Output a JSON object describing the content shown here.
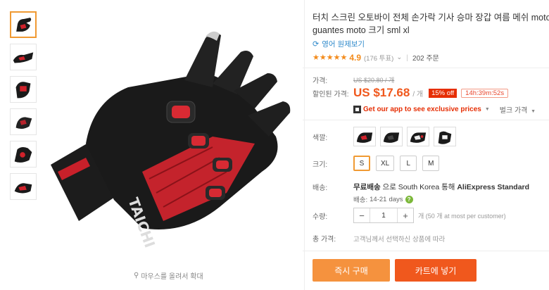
{
  "product": {
    "title_line1": "터치 스크린 오토바이 전체 손가락 기사 승마 장갑 여름 메쉬 moto",
    "title_line2": "guantes moto 크기 sml xl",
    "translate_link": "영어 원제보기",
    "stars": "★★★★★",
    "rating": "4.9",
    "votes": "(176 투표)",
    "votes_arrow": "⌄",
    "orders": "202 주문"
  },
  "price": {
    "label_price": "가격:",
    "old_price": "US $20.80 / 개",
    "label_discount": "할인된 가격:",
    "current": "US $17.68",
    "per_unit": "/ 개",
    "off_badge": "15% off",
    "timer": "14h:39m:52s",
    "app_promo": "Get our app to see exclusive prices",
    "bulk": "벌크 가격"
  },
  "options": {
    "color_label": "색깔:",
    "size_label": "크기:",
    "sizes": [
      "S",
      "XL",
      "L",
      "M"
    ],
    "selected_size": "S"
  },
  "shipping": {
    "label": "배송:",
    "main_pre": "무료배송",
    "main_mid": " 으로 South Korea 통해 ",
    "main_carrier": "AliExpress Standard",
    "sub_pre": "배송:",
    "sub_days": "14-21",
    "sub_unit": "days"
  },
  "quantity": {
    "label": "수량:",
    "minus": "−",
    "value": "1",
    "plus": "+",
    "note": "개 (50 개 at most per customer)"
  },
  "total": {
    "label": "총 가격:",
    "text": "고객님께서 선택하신 상품에 따라"
  },
  "actions": {
    "buy": "즉시 구매",
    "cart": "카트에 넣기"
  },
  "gallery": {
    "zoom_hint": "마우스를 올려서 확대"
  },
  "colors": {
    "accent": "#f0581d",
    "buy": "#f5923e",
    "link": "#2f8acb",
    "badge": "#e62e04",
    "star": "#f38b1b"
  }
}
